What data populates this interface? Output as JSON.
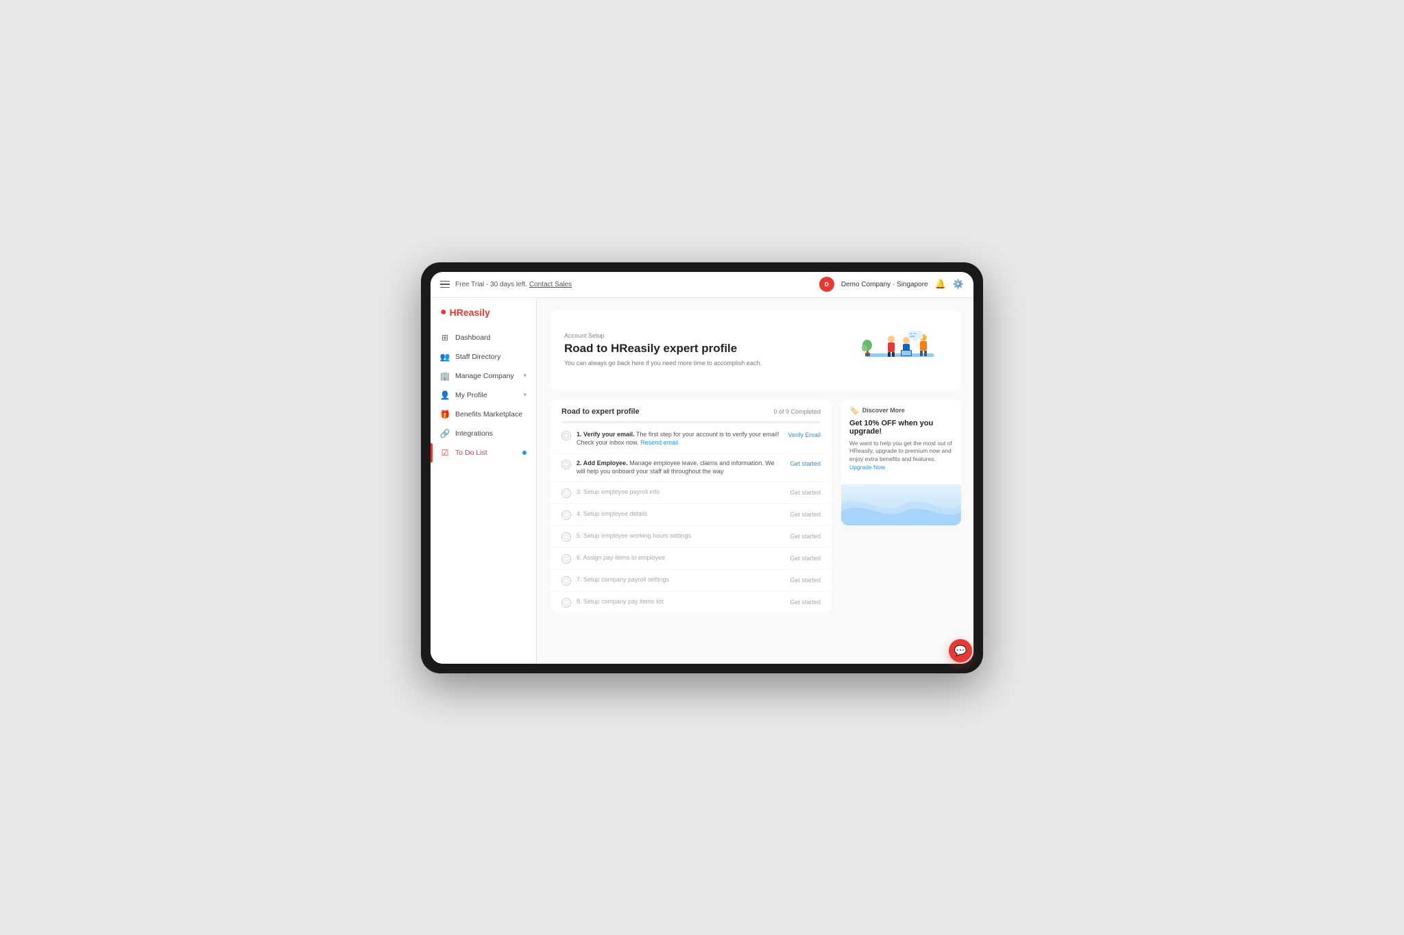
{
  "app": {
    "logo_text": "HReasily",
    "trial_text": "Free Trial - 30 days left.",
    "contact_sales": "Contact Sales",
    "company_name": "Demo Company · Singapore",
    "company_initials": "D"
  },
  "sidebar": {
    "items": [
      {
        "id": "dashboard",
        "label": "Dashboard",
        "icon": "grid"
      },
      {
        "id": "staff-directory",
        "label": "Staff Directory",
        "icon": "users"
      },
      {
        "id": "manage-company",
        "label": "Manage Company",
        "icon": "building",
        "has_arrow": true
      },
      {
        "id": "my-profile",
        "label": "My Profile",
        "icon": "user",
        "has_arrow": true
      },
      {
        "id": "benefits-marketplace",
        "label": "Benefits Marketplace",
        "icon": "gift"
      },
      {
        "id": "integrations",
        "label": "Integrations",
        "icon": "link"
      },
      {
        "id": "to-do-list",
        "label": "To Do List",
        "icon": "list",
        "active": true,
        "has_dot": true
      }
    ]
  },
  "hero": {
    "account_setup_label": "Account Setup",
    "title": "Road to HReasily expert profile",
    "description": "You can always go back here if you need more time to accomplish each."
  },
  "progress": {
    "section_title": "Road to expert profile",
    "count_text": "0 of 9 Completed",
    "tasks": [
      {
        "id": 1,
        "text_bold": "1. Verify your email.",
        "text": " The first step for your account is to verify your email! Check your inbox now.",
        "sub_link": "Resend email",
        "action_label": "Verify Email",
        "active": true,
        "faded": false
      },
      {
        "id": 2,
        "text_bold": "2. Add Employee.",
        "text": " Manage employee leave, claims and information. We will help you onboard your staff all throughout the way",
        "sub_link": "",
        "action_label": "Get started",
        "active": true,
        "faded": false
      },
      {
        "id": 3,
        "text_bold": "3. Setup employee payroll info",
        "text": "",
        "sub_link": "",
        "action_label": "Get started",
        "active": false,
        "faded": true
      },
      {
        "id": 4,
        "text_bold": "4. Setup employee details",
        "text": "",
        "sub_link": "",
        "action_label": "Get started",
        "active": false,
        "faded": true
      },
      {
        "id": 5,
        "text_bold": "5. Setup employee working hours settings",
        "text": "",
        "sub_link": "",
        "action_label": "Get started",
        "active": false,
        "faded": true
      },
      {
        "id": 6,
        "text_bold": "6. Assign pay items to employee",
        "text": "",
        "sub_link": "",
        "action_label": "Get started",
        "active": false,
        "faded": true
      },
      {
        "id": 7,
        "text_bold": "7. Setup company payroll settings",
        "text": "",
        "sub_link": "",
        "action_label": "Get started",
        "active": false,
        "faded": true
      },
      {
        "id": 8,
        "text_bold": "8. Setup company pay items list",
        "text": "",
        "sub_link": "",
        "action_label": "Get started",
        "active": false,
        "faded": true
      }
    ]
  },
  "discover": {
    "section_label": "Discover More",
    "title": "Get 10% OFF when you upgrade!",
    "description": "We want to help you get the most out of HReasily, upgrade to premium now and enjoy extra benefits and features.",
    "upgrade_link": "Upgrade Now"
  },
  "chat_button": {
    "icon": "💬"
  }
}
